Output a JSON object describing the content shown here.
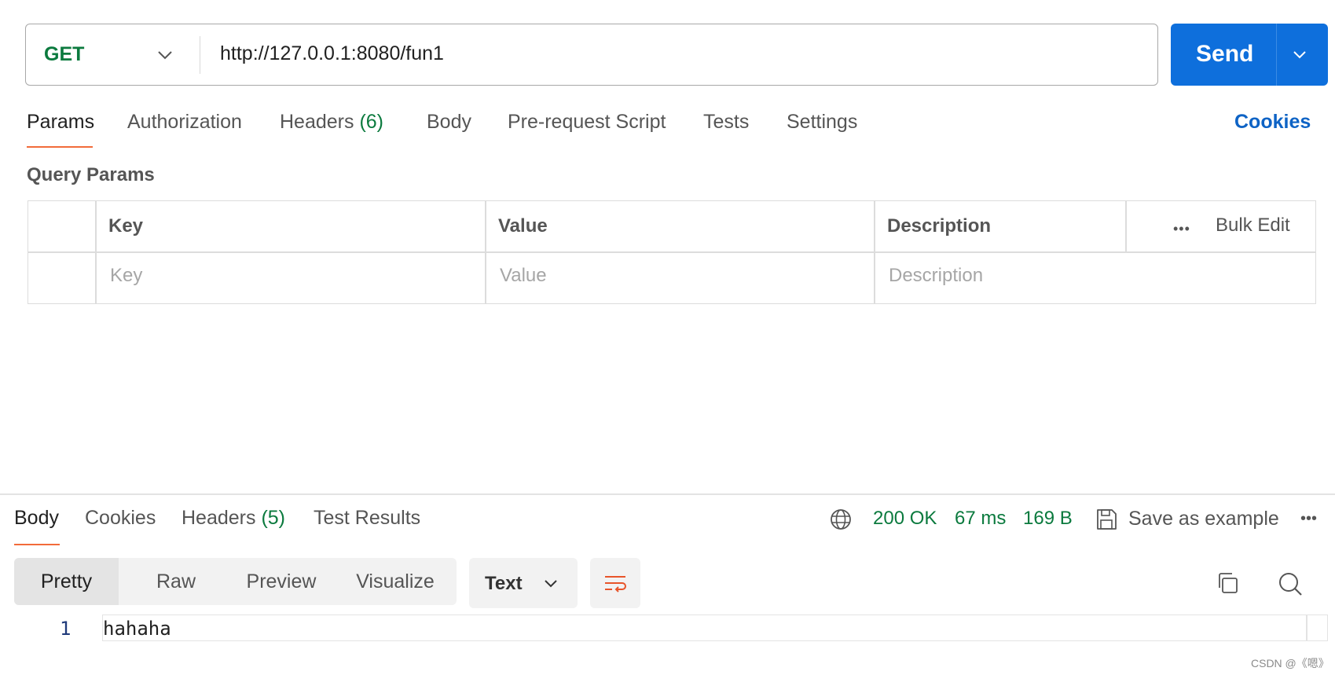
{
  "request": {
    "method": "GET",
    "url": "http://127.0.0.1:8080/fun1",
    "send_label": "Send"
  },
  "request_tabs": {
    "params": "Params",
    "authorization": "Authorization",
    "headers": "Headers",
    "headers_count": "(6)",
    "body": "Body",
    "pre_request_script": "Pre-request Script",
    "tests": "Tests",
    "settings": "Settings",
    "cookies": "Cookies",
    "active": "Params"
  },
  "query_params": {
    "title": "Query Params",
    "columns": {
      "key": "Key",
      "value": "Value",
      "description": "Description"
    },
    "bulk_edit": "Bulk Edit",
    "placeholders": {
      "key": "Key",
      "value": "Value",
      "description": "Description"
    }
  },
  "response": {
    "tabs": {
      "body": "Body",
      "cookies": "Cookies",
      "headers": "Headers",
      "headers_count": "(5)",
      "test_results": "Test Results",
      "active": "Body"
    },
    "status": "200 OK",
    "time": "67 ms",
    "size": "169 B",
    "save_as_example": "Save as example",
    "views": [
      "Pretty",
      "Raw",
      "Preview",
      "Visualize"
    ],
    "active_view": "Pretty",
    "format": "Text",
    "lines": [
      {
        "number": "1",
        "text": "hahaha"
      }
    ]
  },
  "colors": {
    "method_green": "#0b7a3e",
    "send_blue": "#0e6fdc",
    "link_blue": "#0e63c5",
    "tab_underline_orange": "#f26b3a",
    "wrap_icon_orange": "#e8542a"
  },
  "icons": [
    "chevron-down-icon",
    "globe-icon",
    "save-icon",
    "more-icon",
    "wrap-lines-icon",
    "copy-icon",
    "search-icon"
  ],
  "watermark": "CSDN @《嗯》"
}
